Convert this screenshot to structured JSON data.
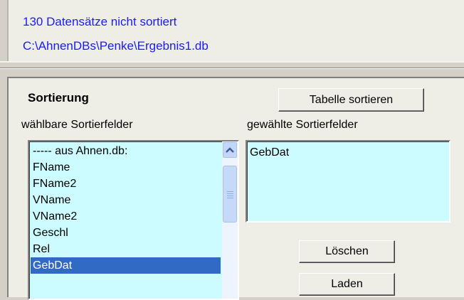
{
  "info": {
    "status_line": "130 Datensätze nicht sortiert",
    "path_line": "C:\\AhnenDBs\\Penke\\Ergebnis1.db",
    "text_color": "#1a1aff"
  },
  "sort": {
    "heading": "Sortierung",
    "sort_table_button": "Tabelle sortieren",
    "available_label": "wählbare Sortierfelder",
    "chosen_label": "gewählte Sortierfelder",
    "available_fields": [
      "----- aus Ahnen.db:",
      "FName",
      "FName2",
      "VName",
      "VName2",
      "Geschl",
      "Rel",
      "GebDat"
    ],
    "selected_available": "GebDat",
    "chosen_fields": [
      "GebDat"
    ],
    "delete_button": "Löschen",
    "load_button": "Laden",
    "list_bg": "#ccfcff",
    "selection_color": "#316ac5"
  },
  "icons": {
    "scroll_up": "chevron-up-icon",
    "scroll_grip": "grip-icon"
  }
}
